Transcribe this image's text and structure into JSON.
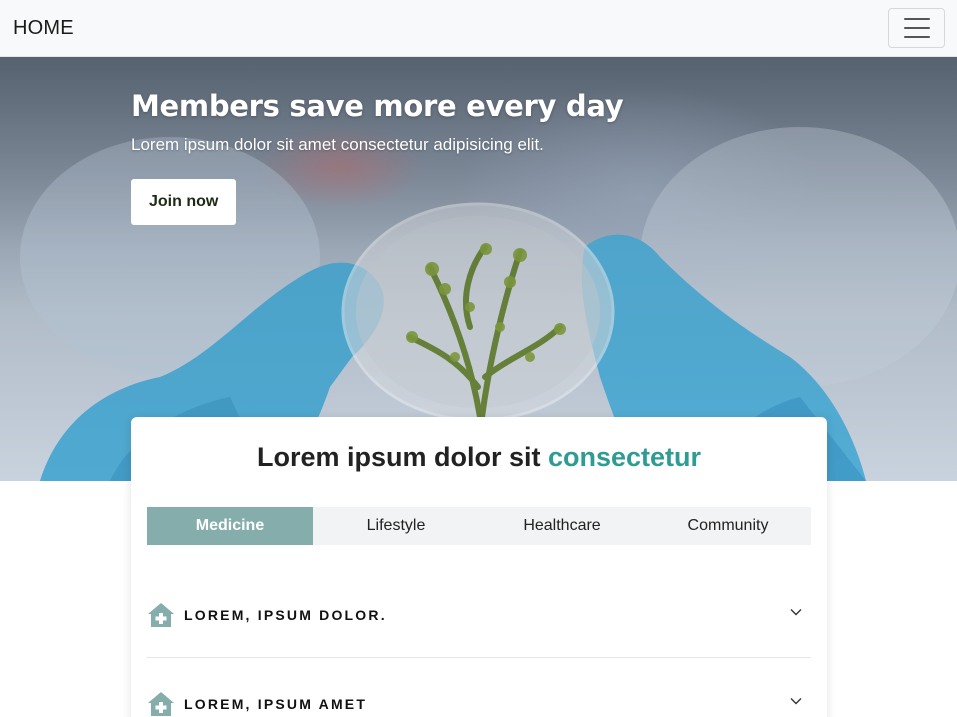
{
  "navbar": {
    "brand": "HOME",
    "toggler_icon": "hamburger-menu-icon"
  },
  "hero": {
    "title": "Members save more every day",
    "subtitle": "Lorem ipsum dolor sit amet consectetur adipisicing elit.",
    "cta_label": "Join now"
  },
  "section": {
    "title_main": "Lorem ipsum dolor sit ",
    "title_accent": "consectetur",
    "accent_color": "#2f9c93",
    "tabs": [
      {
        "label": "Medicine",
        "active": true
      },
      {
        "label": "Lifestyle",
        "active": false
      },
      {
        "label": "Healthcare",
        "active": false
      },
      {
        "label": "Community",
        "active": false
      }
    ],
    "tab_active_color": "#84adab",
    "accordion": [
      {
        "label": "LOREM, IPSUM DOLOR.",
        "icon": "medical-house-icon"
      },
      {
        "label": "LOREM, IPSUM AMET",
        "icon": "medical-house-icon"
      }
    ]
  }
}
